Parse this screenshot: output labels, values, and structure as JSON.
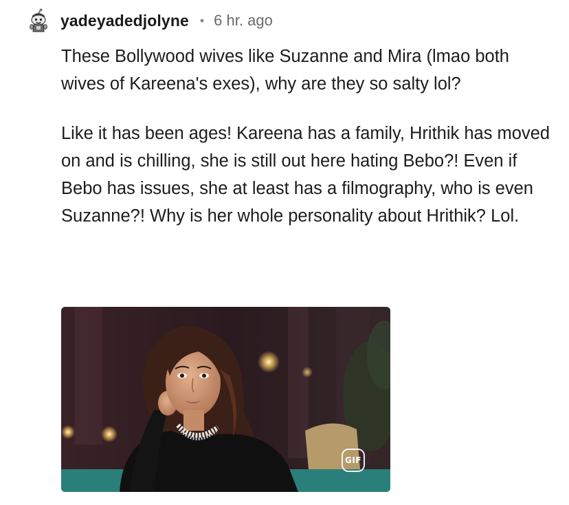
{
  "comment": {
    "username": "yadeyadedjolyne",
    "separator": "•",
    "timestamp": "6 hr. ago",
    "avatar_icon": "snoo-avatar-icon",
    "paragraphs": [
      "These Bollywood wives like Suzanne and Mira (lmao both wives of Kareena's exes), why are they so salty lol?",
      "Like it has been ages! Kareena has a family, Hrithik has moved on and is chilling, she is still out here hating Bebo?! Even if Bebo has issues, she at least has a filmography, who is even Suzanne?! Why is her whole personality about Hrithik? Lol."
    ],
    "media": {
      "type": "gif",
      "badge_label": "GIF"
    }
  }
}
